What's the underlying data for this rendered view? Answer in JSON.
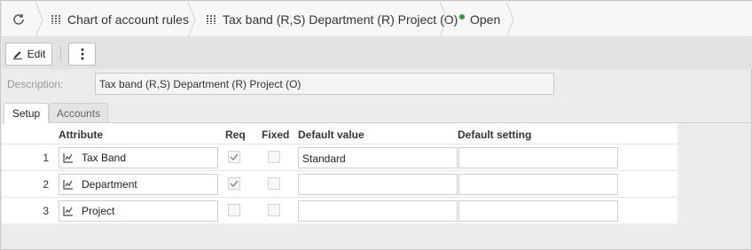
{
  "breadcrumb": {
    "refresh_icon": "refresh-icon",
    "items": [
      {
        "label": "Chart of account rules",
        "icon": "grid-icon"
      },
      {
        "label": "Tax band (R,S) Department (R) Project (O)",
        "icon": "grid-icon"
      }
    ],
    "status": {
      "label": "Open",
      "color": "#2e9d3a"
    }
  },
  "toolbar": {
    "edit_label": "Edit",
    "edit_icon": "pencil-icon",
    "more_icon": "more-vertical-icon"
  },
  "description": {
    "label": "Description:",
    "value": "Tax band (R,S) Department (R) Project (O)"
  },
  "tabs": [
    {
      "label": "Setup",
      "active": true
    },
    {
      "label": "Accounts",
      "active": false
    }
  ],
  "table": {
    "headers": {
      "attribute": "Attribute",
      "req": "Req",
      "fixed": "Fixed",
      "default_value": "Default value",
      "default_setting": "Default setting"
    },
    "rows": [
      {
        "num": "1",
        "attribute": "Tax Band",
        "req": true,
        "fixed": false,
        "default_value": "Standard",
        "default_setting": ""
      },
      {
        "num": "2",
        "attribute": "Department",
        "req": true,
        "fixed": false,
        "default_value": "",
        "default_setting": ""
      },
      {
        "num": "3",
        "attribute": "Project",
        "req": false,
        "fixed": false,
        "default_value": "",
        "default_setting": ""
      }
    ]
  },
  "colors": {
    "status_green": "#2e9d3a",
    "toolbar_bg": "#e2e2e2"
  }
}
